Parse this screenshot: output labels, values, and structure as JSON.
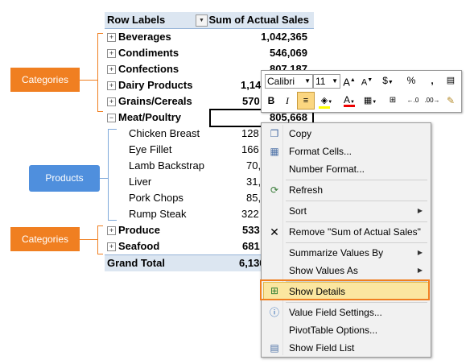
{
  "pivot": {
    "header": {
      "row_labels": "Row Labels",
      "value_header": "Sum of Actual Sales"
    },
    "rows": [
      {
        "label": "Beverages",
        "value": "1,042,365"
      },
      {
        "label": "Condiments",
        "value": "546,069"
      },
      {
        "label": "Confections",
        "value": "807,187"
      },
      {
        "label": "Dairy Products",
        "value": "1,14"
      },
      {
        "label": "Grains/Cereals",
        "value": "570"
      },
      {
        "label": "Meat/Poultry",
        "value": "805,668"
      }
    ],
    "products": [
      {
        "label": "Chicken Breast",
        "value": "128"
      },
      {
        "label": "Eye Fillet",
        "value": "166"
      },
      {
        "label": "Lamb Backstrap",
        "value": "70,"
      },
      {
        "label": "Liver",
        "value": "31,"
      },
      {
        "label": "Pork Chops",
        "value": "85,"
      },
      {
        "label": "Rump Steak",
        "value": "322"
      }
    ],
    "more_rows": [
      {
        "label": "Produce",
        "value": "533"
      },
      {
        "label": "Seafood",
        "value": "681"
      }
    ],
    "grand_total": {
      "label": "Grand Total",
      "value": "6,130"
    }
  },
  "callouts": {
    "categories_top": "Categories",
    "products": "Products",
    "categories_bottom": "Categories"
  },
  "mini_toolbar": {
    "font": "Calibri",
    "size": "11",
    "row1": [
      "A",
      "A",
      "$",
      "%",
      ","
    ],
    "row2": [
      "B",
      "I"
    ]
  },
  "context_menu": {
    "items": [
      {
        "label": "Copy",
        "icon": "copy-icon"
      },
      {
        "label": "Format Cells...",
        "icon": "format-cells-icon"
      },
      {
        "label": "Number Format...",
        "icon": ""
      },
      {
        "label": "Refresh",
        "icon": "refresh-icon"
      },
      {
        "label": "Sort",
        "icon": ""
      },
      {
        "label": "Remove \"Sum of Actual Sales\"",
        "icon": "remove-icon"
      },
      {
        "label": "Summarize Values By",
        "icon": ""
      },
      {
        "label": "Show Values As",
        "icon": ""
      },
      {
        "label": "Show Details",
        "icon": "show-details-icon"
      },
      {
        "label": "Value Field Settings...",
        "icon": "value-field-settings-icon"
      },
      {
        "label": "PivotTable Options...",
        "icon": ""
      },
      {
        "label": "Show Field List",
        "icon": "field-list-icon"
      }
    ]
  },
  "colors": {
    "accent_orange": "#f07f21",
    "callout_blue": "#4f8fdd",
    "header_fill": "#dce6f1",
    "highlight": "#fbe6a0"
  }
}
